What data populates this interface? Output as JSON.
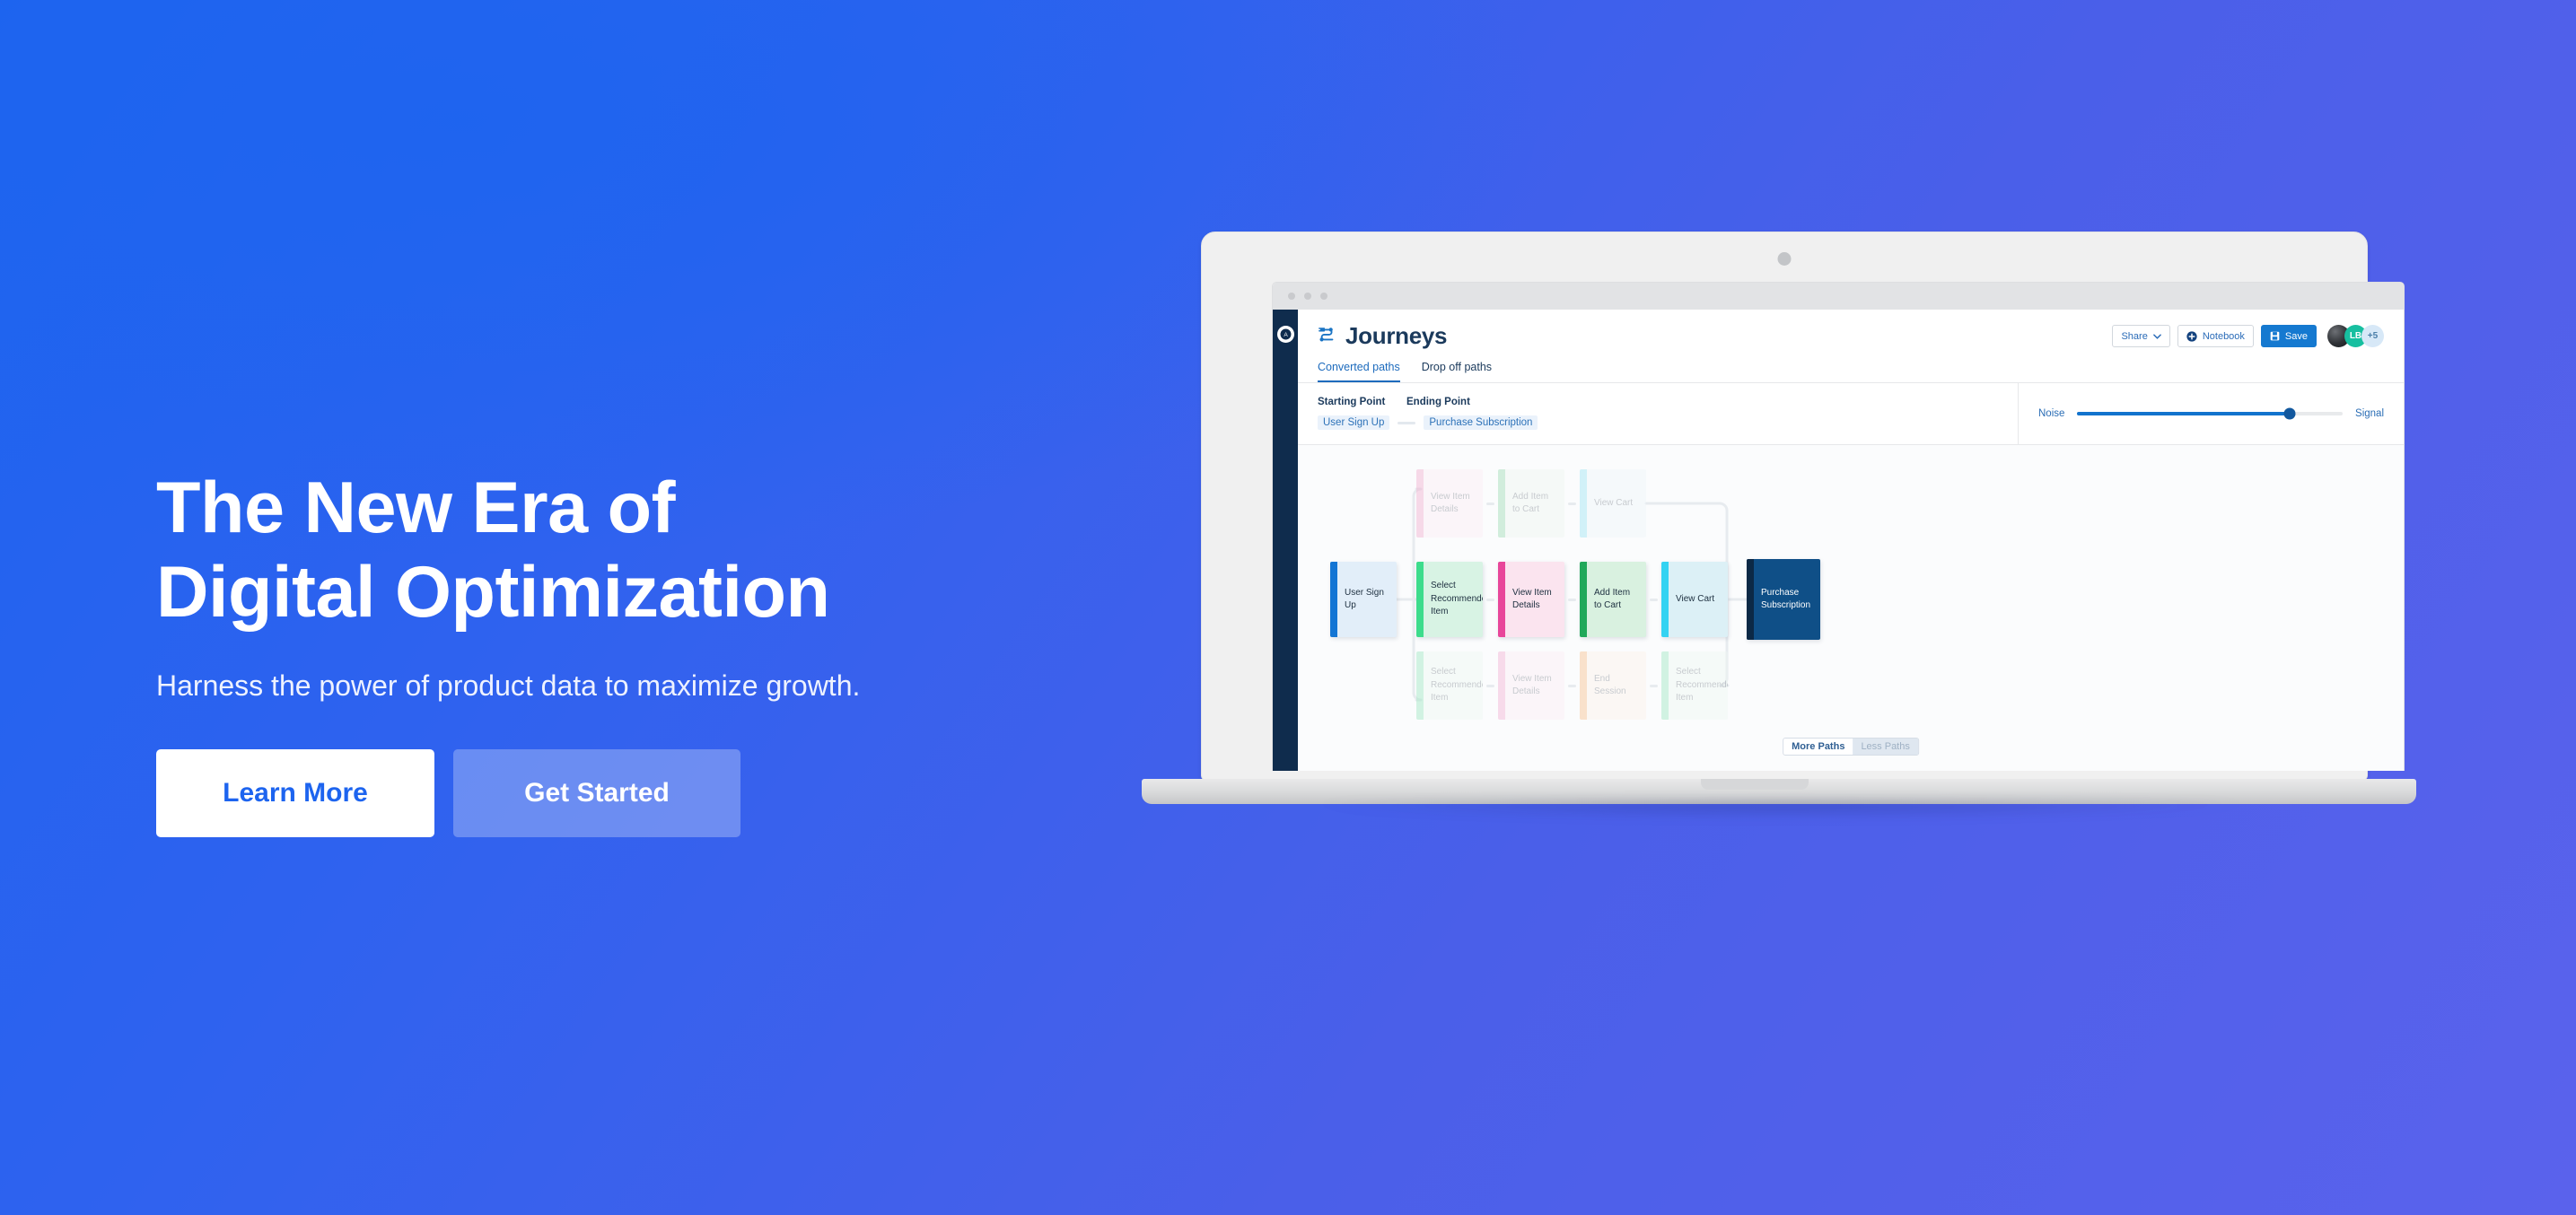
{
  "hero": {
    "title": "The New Era of\nDigital Optimization",
    "subtitle": "Harness the power of product data to maximize growth.",
    "primary_button": "Learn More",
    "secondary_button": "Get Started"
  },
  "colors": {
    "bg_start": "#1d64ef",
    "bg_end": "#5a62ec",
    "accent_blue": "#1d64ef",
    "app_rail": "#0f2c4d",
    "save_button": "#1579d0",
    "terminal_node": "#0f4f87"
  },
  "app": {
    "rail_icon": "analytics-logo-icon",
    "brand": "Journeys",
    "brand_icon": "journeys-flow-icon",
    "header_actions": {
      "share": "Share",
      "share_caret_icon": "chevron-down-icon",
      "notebook": "Notebook",
      "notebook_icon": "plus-circle-icon",
      "save": "Save",
      "save_icon": "floppy-disk-icon",
      "avatar_initials": "LB",
      "avatar_overflow": "+5"
    },
    "tabs": [
      {
        "label": "Converted paths",
        "active": true
      },
      {
        "label": "Drop off paths",
        "active": false
      }
    ],
    "filters": {
      "starting_point_label": "Starting Point",
      "ending_point_label": "Ending Point",
      "starting_point_value": "User Sign Up",
      "ending_point_value": "Purchase Subscription"
    },
    "slider": {
      "left_label": "Noise",
      "right_label": "Signal",
      "value_percent": 80
    },
    "path_toggle": {
      "more": "More Paths",
      "less": "Less Paths"
    }
  },
  "flow": {
    "start": {
      "label": "User Sign Up",
      "bar": "#1375d4",
      "bg": "#e2eef9"
    },
    "end": {
      "label": "Purchase Subscription",
      "bar": "#0c2946",
      "bg": "#0f4f87"
    },
    "rows": [
      {
        "name": "top-row",
        "faded": true,
        "nodes": [
          {
            "label": "View Item Details",
            "bar": "#f2afd0",
            "bg": "#fbeef5"
          },
          {
            "label": "Add Item to Cart",
            "bar": "#9fdcb6",
            "bg": "#eff7f1"
          },
          {
            "label": "View Cart",
            "bar": "#9fe4f2",
            "bg": "#eef7fa"
          }
        ]
      },
      {
        "name": "main-row",
        "faded": false,
        "nodes": [
          {
            "label": "Select Recommended Item",
            "bar": "#3ddc8c",
            "bg": "#d8f3e4"
          },
          {
            "label": "View Item Details",
            "bar": "#e8469a",
            "bg": "#fbe4ef"
          },
          {
            "label": "Add Item to Cart",
            "bar": "#21a85a",
            "bg": "#d9f1e0"
          },
          {
            "label": "View Cart",
            "bar": "#34d3f2",
            "bg": "#dcf0f6"
          }
        ]
      },
      {
        "name": "bottom-row",
        "faded": true,
        "nodes": [
          {
            "label": "Select Recommended Item",
            "bar": "#9fe8c2",
            "bg": "#eef8f2"
          },
          {
            "label": "View Item Details",
            "bar": "#f3b2d5",
            "bg": "#fbeef5"
          },
          {
            "label": "End Session",
            "bar": "#f7c290",
            "bg": "#fbf2ea"
          },
          {
            "label": "Select Recommended Item",
            "bar": "#9fe8c2",
            "bg": "#eef8f2"
          }
        ]
      }
    ]
  }
}
